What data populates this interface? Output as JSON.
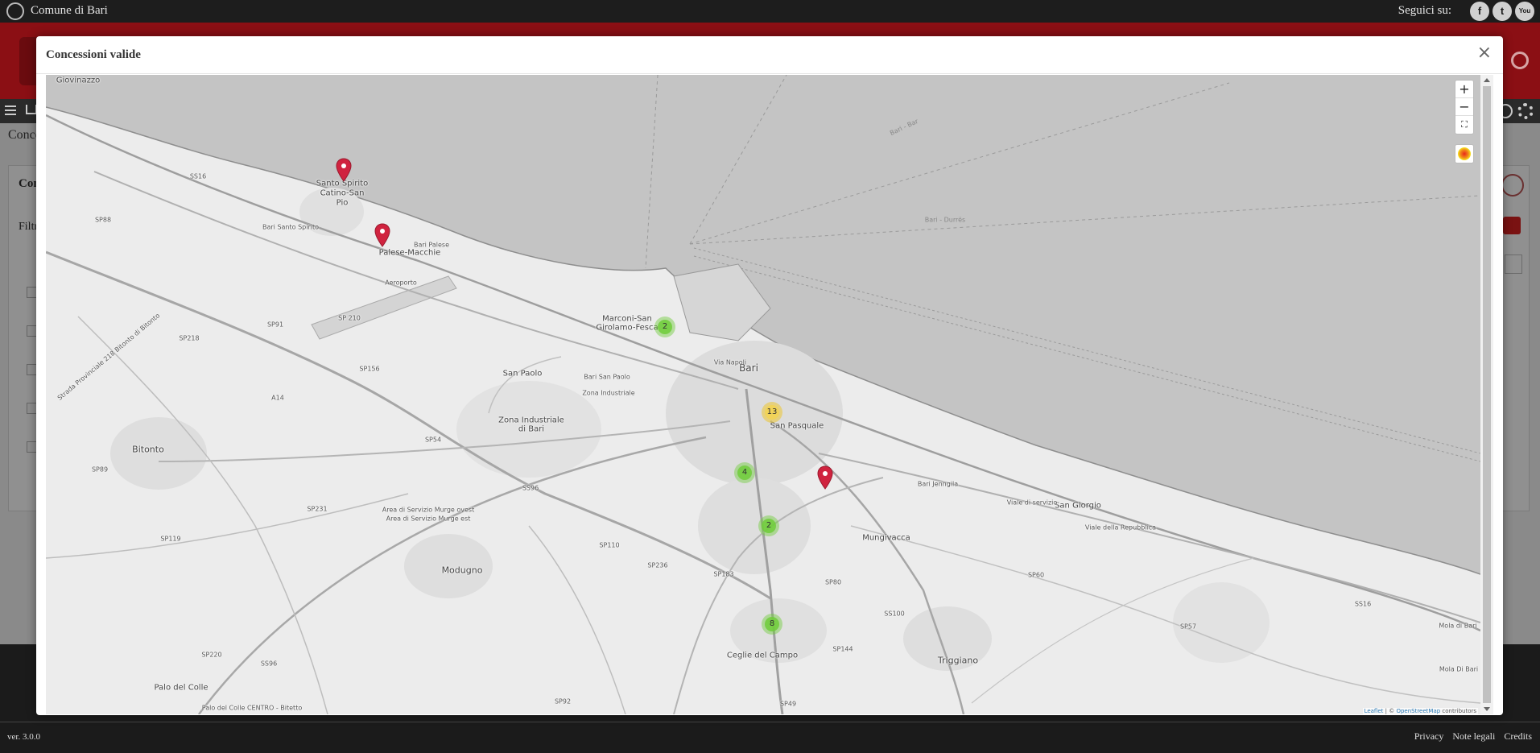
{
  "topbar": {
    "site_name": "Comune di Bari",
    "follow_label": "Seguici su:",
    "social": [
      "f",
      "t",
      "You"
    ]
  },
  "page": {
    "title": "Conce",
    "panel_title": "Con",
    "filter_label": "Filtr"
  },
  "footer": {
    "version": "ver. 3.0.0",
    "links": [
      "Privacy",
      "Note legali",
      "Credits"
    ]
  },
  "modal": {
    "title": "Concessioni valide",
    "close_label": "×"
  },
  "map": {
    "zoom_in": "+",
    "zoom_out": "−",
    "fullscreen": "⛶",
    "attribution": {
      "leaflet": "Leaflet",
      "sep": " | © ",
      "osm": "OpenStreetMap",
      "tail": " contributors"
    },
    "places": [
      "Giovinazzo",
      "Santo Spirito",
      "Catino-San",
      "Pio",
      "Palese-Macchie",
      "Marconi-San",
      "Girolamo-Fesca",
      "Bari",
      "San Paolo",
      "San Pasquale",
      "Zona Industriale",
      "di Bari",
      "Bitonto",
      "Modugno",
      "Mungivacca",
      "Triggiano",
      "Ceglie del Campo",
      "Palo del Colle",
      "San Giorgio"
    ],
    "roads": [
      "SS16",
      "SP88",
      "SP91",
      "SP218",
      "SP 210",
      "SP156",
      "A14",
      "SP54",
      "SP89",
      "SP231",
      "SP119",
      "SP220",
      "SS96",
      "SS96",
      "SP236",
      "SP183",
      "SP110",
      "SP80",
      "SS100",
      "SP144",
      "SP92",
      "SP49",
      "SP60",
      "SP57",
      "SS16",
      "Aeroporto",
      "Bari Santo Spirito",
      "Bari - Durrës",
      "Bari - Bar",
      "Area di Servizio Murge ovest",
      "Area di Servizio Murge est",
      "Bari San Paolo",
      "Zona Industriale",
      "Bari Palese",
      "Via Napoli",
      "Viale della Repubblica",
      "Mola di Bari",
      "Mola Di Bari",
      "Palo del Colle CENTRO - Bitetto",
      "Bari Jenngila",
      "Viale di servizio",
      "Strada Provinciale 218 Bitonto di Bitonto"
    ],
    "clusters": [
      {
        "count": "2",
        "level": "green"
      },
      {
        "count": "13",
        "level": "yellow"
      },
      {
        "count": "4",
        "level": "green"
      },
      {
        "count": "2",
        "level": "green"
      },
      {
        "count": "8",
        "level": "green"
      }
    ],
    "markers_count": 3,
    "colors": {
      "sea": "#c4c4c4",
      "land": "#ececec",
      "marker": "#d0233f",
      "cluster_green": "#6ecc39",
      "cluster_yellow": "#f1c40f"
    }
  }
}
